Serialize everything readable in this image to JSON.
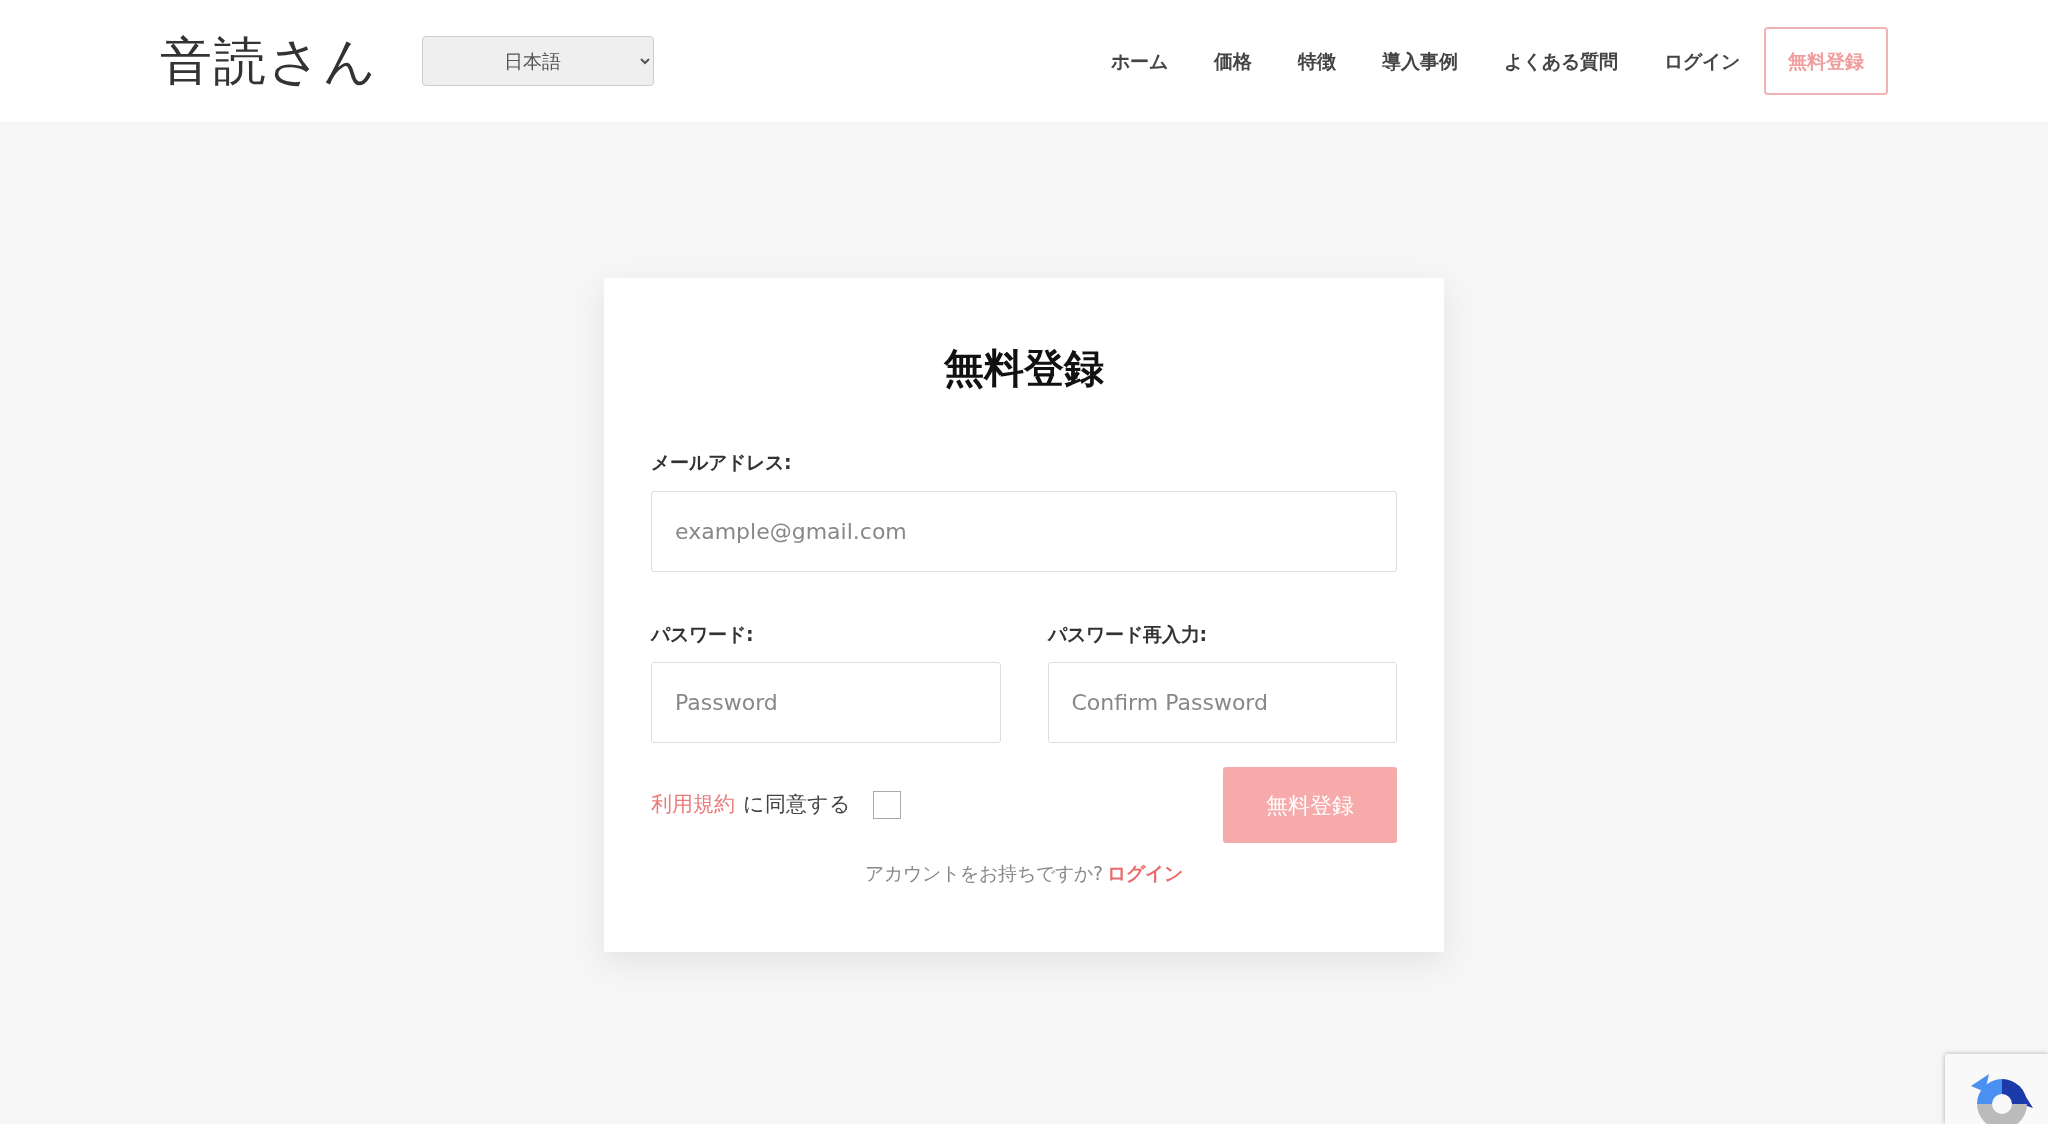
{
  "header": {
    "logo": "音読さん",
    "language_select": {
      "value": "日本語"
    },
    "nav": [
      {
        "label": "ホーム"
      },
      {
        "label": "価格"
      },
      {
        "label": "特徴"
      },
      {
        "label": "導入事例"
      },
      {
        "label": "よくある質問"
      },
      {
        "label": "ログイン"
      }
    ],
    "signup_button": "無料登録"
  },
  "form": {
    "title": "無料登録",
    "email": {
      "label": "メールアドレス:",
      "placeholder": "example@gmail.com"
    },
    "password": {
      "label": "パスワード:",
      "placeholder": "Password"
    },
    "confirm_password": {
      "label": "パスワード再入力:",
      "placeholder": "Confirm Password"
    },
    "terms": {
      "link": "利用規約",
      "text": "に同意する",
      "checked": false
    },
    "submit": {
      "label": "無料登録",
      "disabled": true
    },
    "login_prompt": {
      "text": "アカウントをお持ちですか?",
      "link": "ログイン"
    }
  }
}
